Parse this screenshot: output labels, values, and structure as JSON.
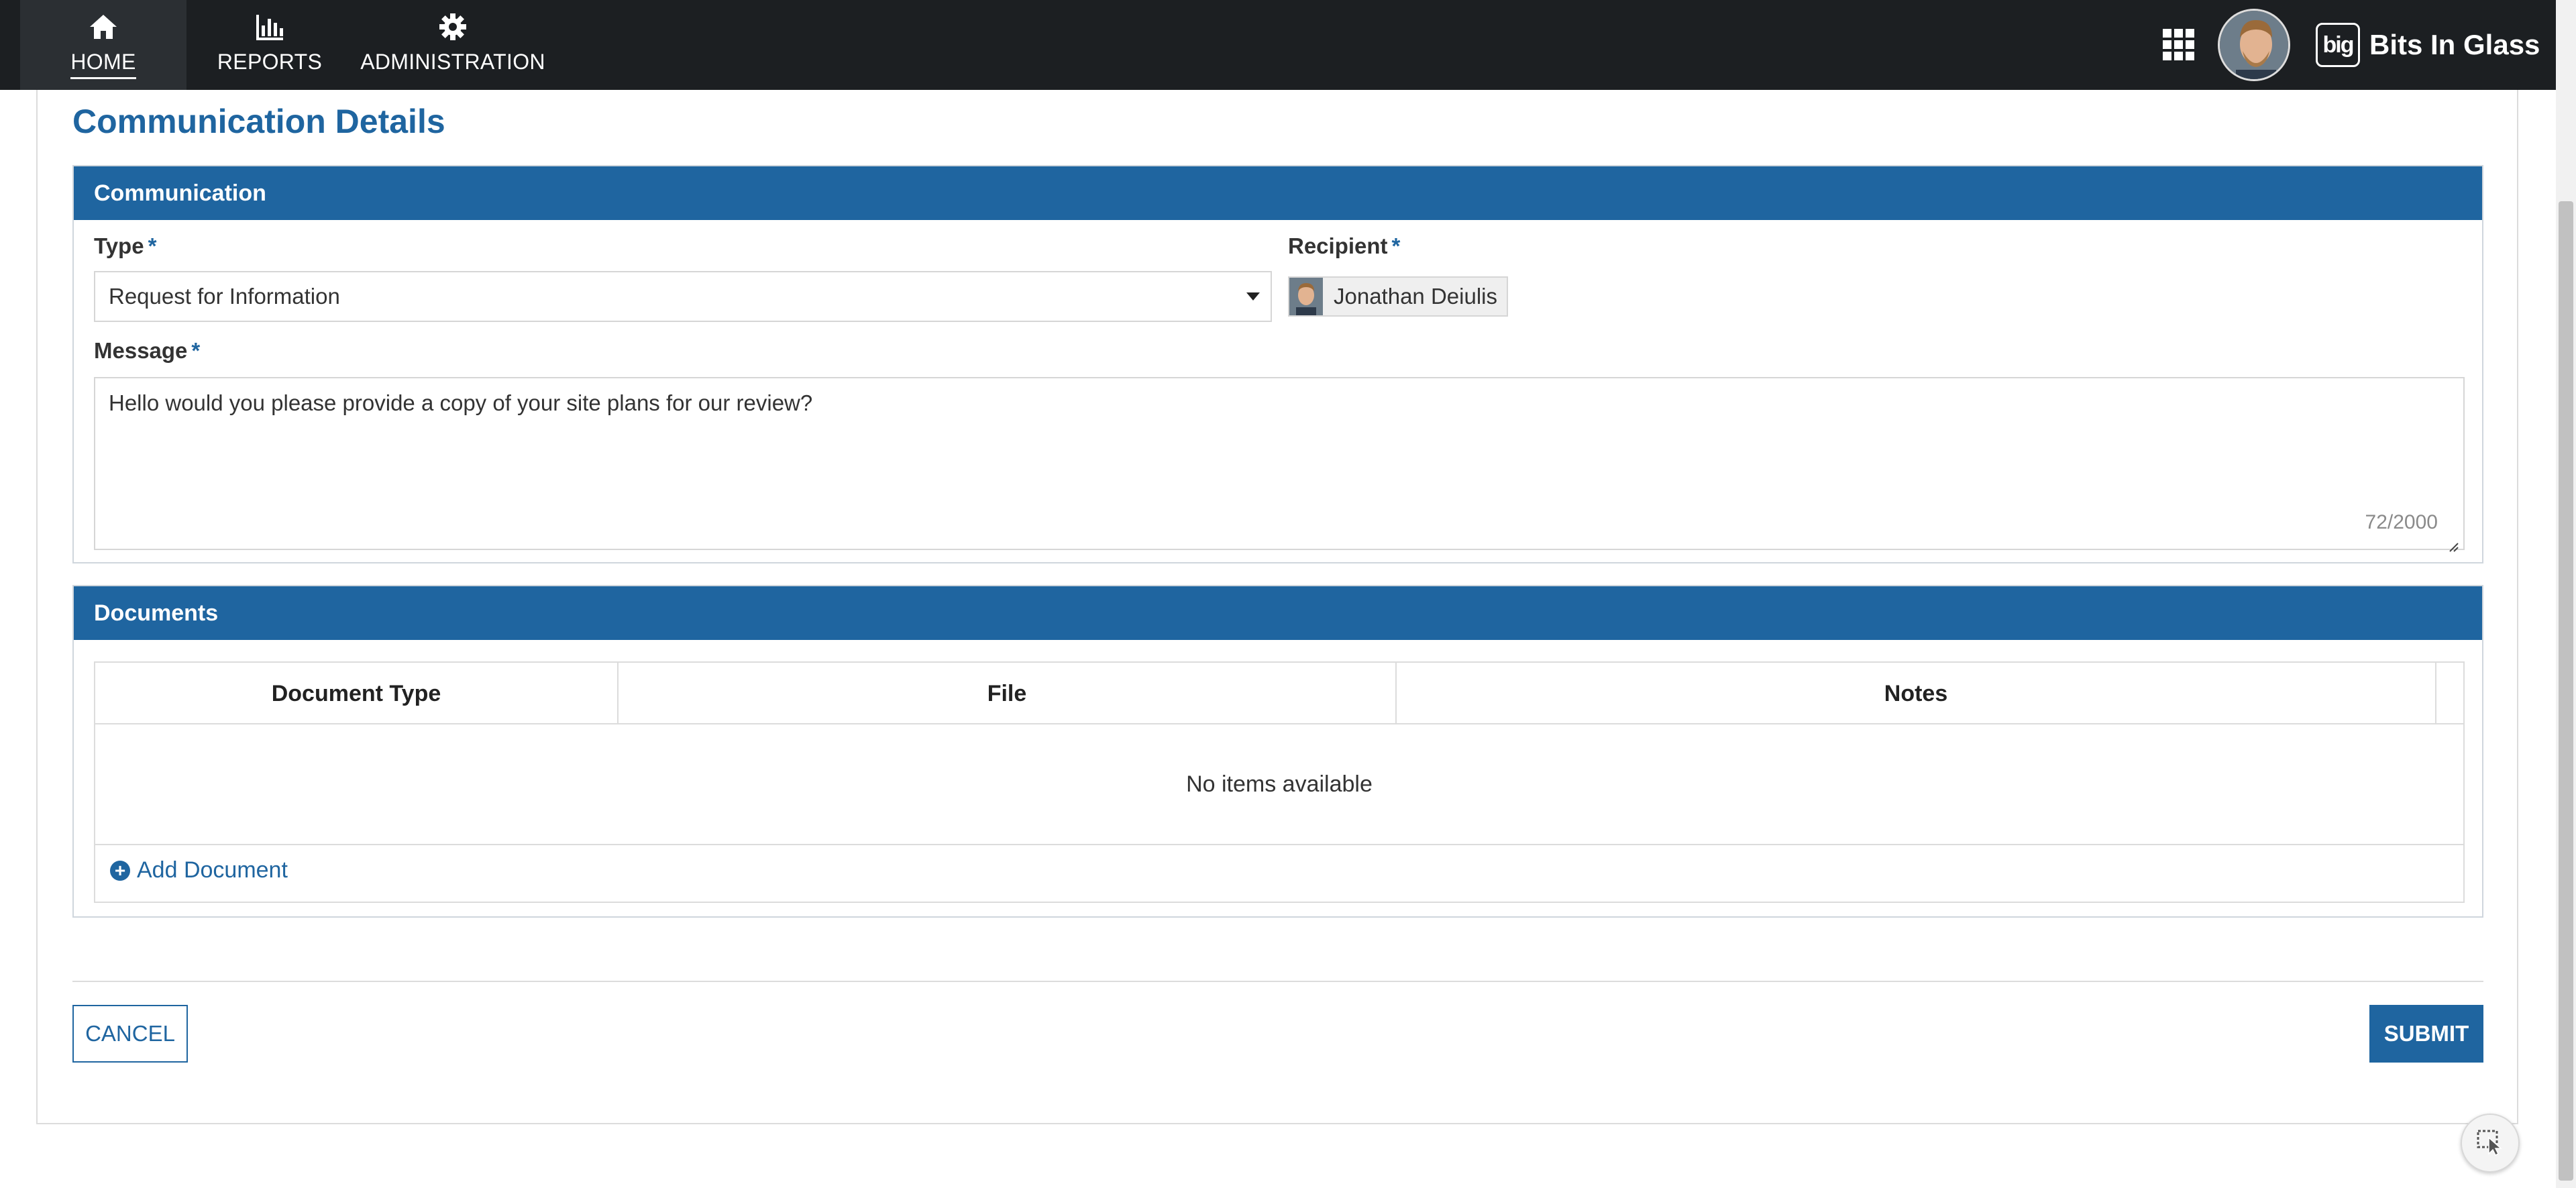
{
  "nav": {
    "items": [
      {
        "label": "HOME",
        "icon": "home-icon",
        "active": true
      },
      {
        "label": "REPORTS",
        "icon": "bar-chart-icon",
        "active": false
      },
      {
        "label": "ADMINISTRATION",
        "icon": "gear-icon",
        "active": false
      }
    ],
    "brand_logo_text": "big",
    "brand_name": "Bits In Glass"
  },
  "page": {
    "title": "Communication Details"
  },
  "communication": {
    "header": "Communication",
    "type_label": "Type",
    "type_value": "Request for Information",
    "recipient_label": "Recipient",
    "recipient_name": "Jonathan Deiulis",
    "message_label": "Message",
    "message_value": "Hello would you please provide a copy of your site plans for our review?",
    "char_count": "72/2000",
    "required_marker": "*"
  },
  "documents": {
    "header": "Documents",
    "columns": [
      "Document Type",
      "File",
      "Notes"
    ],
    "empty_text": "No items available",
    "add_label": "Add Document",
    "add_icon": "+"
  },
  "actions": {
    "cancel_label": "CANCEL",
    "submit_label": "SUBMIT"
  },
  "colors": {
    "nav_bg": "#1c1f22",
    "accent": "#1f65a0"
  }
}
